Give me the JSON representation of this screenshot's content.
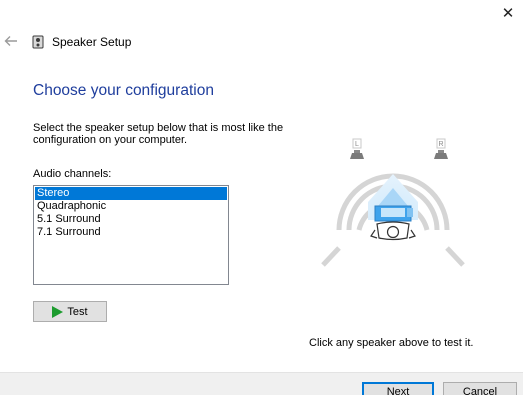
{
  "window": {
    "close_glyph": "✕"
  },
  "header": {
    "title": "Speaker Setup"
  },
  "main": {
    "heading": "Choose your configuration",
    "instructions": "Select the speaker setup below that is most like the configuration on your computer.",
    "channels_label": "Audio channels:",
    "channels": [
      {
        "label": "Stereo",
        "selected": true
      },
      {
        "label": "Quadraphonic",
        "selected": false
      },
      {
        "label": "5.1 Surround",
        "selected": false
      },
      {
        "label": "7.1 Surround",
        "selected": false
      }
    ],
    "test_label": "Test",
    "speaker_left_label": "L",
    "speaker_right_label": "R",
    "hint": "Click any speaker above to test it."
  },
  "footer": {
    "next_label": "Next",
    "cancel_label": "Cancel"
  },
  "colors": {
    "heading": "#1f3e9d",
    "selection": "#0078d7",
    "play_icon": "#1d9c2f"
  }
}
